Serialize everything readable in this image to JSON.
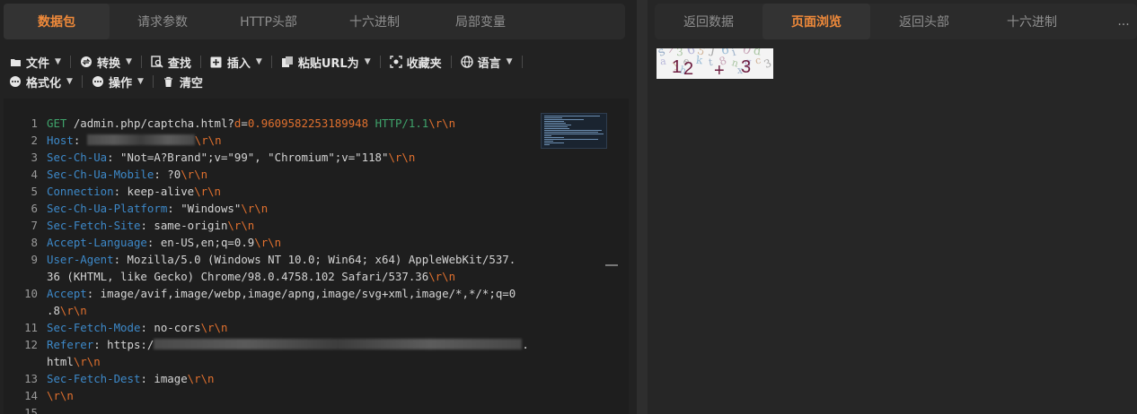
{
  "left_tabs": [
    "数据包",
    "请求参数",
    "HTTP头部",
    "十六进制",
    "局部变量"
  ],
  "toolbar": {
    "row1": [
      {
        "icon": "file-icon",
        "label": "文件",
        "caret": true
      },
      {
        "icon": "convert-icon",
        "label": "转换",
        "caret": true
      },
      {
        "icon": "search-icon",
        "label": "查找",
        "caret": false
      },
      {
        "icon": "plus-square-icon",
        "label": "插入",
        "caret": true
      },
      {
        "icon": "paste-icon",
        "label": "粘贴URL为",
        "caret": true
      },
      {
        "icon": "scan-icon",
        "label": "收藏夹",
        "caret": false
      },
      {
        "icon": "globe-icon",
        "label": "语言",
        "caret": true
      }
    ],
    "row2": [
      {
        "icon": "dots-circle-icon",
        "label": "格式化",
        "caret": true
      },
      {
        "icon": "dots-circle-icon",
        "label": "操作",
        "caret": true
      },
      {
        "icon": "trash-icon",
        "label": "清空",
        "caret": false
      }
    ]
  },
  "editor": {
    "line_numbers": [
      "1",
      "",
      "2",
      "3",
      "4",
      "5",
      "6",
      "7",
      "8",
      "9",
      "",
      "10",
      "",
      "11",
      "12",
      "",
      "13",
      "14",
      "15"
    ],
    "lines": [
      {
        "n": "1",
        "parts": [
          [
            "g",
            "GET"
          ],
          [
            "t",
            " /admin.php/captcha.html?"
          ],
          [
            "o",
            "d"
          ],
          [
            "t",
            "="
          ],
          [
            "o",
            "0.9609582253189948"
          ],
          [
            "t",
            " "
          ],
          [
            "g",
            "HTTP/1.1"
          ],
          [
            "o",
            "\\r\\n"
          ]
        ]
      },
      {
        "n": "2",
        "parts": [
          [
            "k",
            "Host"
          ],
          [
            "t",
            ": "
          ],
          [
            "b",
            "120"
          ],
          [
            "o",
            "\\r\\n"
          ]
        ]
      },
      {
        "n": "3",
        "parts": [
          [
            "k",
            "Sec-Ch-Ua"
          ],
          [
            "t",
            ": \"Not=A?Brand\";v=\"99\", \"Chromium\";v=\"118\""
          ],
          [
            "o",
            "\\r\\n"
          ]
        ]
      },
      {
        "n": "4",
        "parts": [
          [
            "k",
            "Sec-Ch-Ua-Mobile"
          ],
          [
            "t",
            ": ?0"
          ],
          [
            "o",
            "\\r\\n"
          ]
        ]
      },
      {
        "n": "5",
        "parts": [
          [
            "k",
            "Connection"
          ],
          [
            "t",
            ": keep-alive"
          ],
          [
            "o",
            "\\r\\n"
          ]
        ]
      },
      {
        "n": "6",
        "parts": [
          [
            "k",
            "Sec-Ch-Ua-Platform"
          ],
          [
            "t",
            ": \"Windows\""
          ],
          [
            "o",
            "\\r\\n"
          ]
        ]
      },
      {
        "n": "7",
        "parts": [
          [
            "k",
            "Sec-Fetch-Site"
          ],
          [
            "t",
            ": same-origin"
          ],
          [
            "o",
            "\\r\\n"
          ]
        ]
      },
      {
        "n": "8",
        "parts": [
          [
            "k",
            "Accept-Language"
          ],
          [
            "t",
            ": en-US,en;q=0.9"
          ],
          [
            "o",
            "\\r\\n"
          ]
        ]
      },
      {
        "n": "9",
        "parts": [
          [
            "k",
            "User-Agent"
          ],
          [
            "t",
            ": Mozilla/5.0 (Windows NT 10.0; Win64; x64) AppleWebKit/537."
          ]
        ]
      },
      {
        "n": "",
        "parts": [
          [
            "t",
            "36 (KHTML, like Gecko) Chrome/98.0.4758.102 Safari/537.36"
          ],
          [
            "o",
            "\\r\\n"
          ]
        ]
      },
      {
        "n": "10",
        "parts": [
          [
            "k",
            "Accept"
          ],
          [
            "t",
            ": image/avif,image/webp,image/apng,image/svg+xml,image/*,*/*;q=0"
          ]
        ]
      },
      {
        "n": "",
        "parts": [
          [
            "t",
            ".8"
          ],
          [
            "o",
            "\\r\\n"
          ]
        ]
      },
      {
        "n": "11",
        "parts": [
          [
            "k",
            "Sec-Fetch-Mode"
          ],
          [
            "t",
            ": no-cors"
          ],
          [
            "o",
            "\\r\\n"
          ]
        ]
      },
      {
        "n": "12",
        "parts": [
          [
            "k",
            "Referer"
          ],
          [
            "t",
            ": https:/"
          ],
          [
            "b",
            "410"
          ],
          [
            "t",
            "."
          ]
        ]
      },
      {
        "n": "",
        "parts": [
          [
            "t",
            "html"
          ],
          [
            "o",
            "\\r\\n"
          ]
        ]
      },
      {
        "n": "13",
        "parts": [
          [
            "k",
            "Sec-Fetch-Dest"
          ],
          [
            "t",
            ": image"
          ],
          [
            "o",
            "\\r\\n"
          ]
        ]
      },
      {
        "n": "14",
        "parts": [
          [
            "o",
            "\\r\\n"
          ]
        ]
      },
      {
        "n": "15",
        "parts": []
      }
    ]
  },
  "right_tabs": [
    "返回数据",
    "页面浏览",
    "返回头部",
    "十六进制"
  ],
  "right_more": "···",
  "captcha": {
    "main_chars": [
      "1",
      "2",
      "+",
      "3"
    ],
    "noise_chars": [
      "s",
      "7",
      "3",
      "6",
      "5",
      "J",
      "6",
      "i",
      "0",
      "d",
      "a",
      "y",
      "e",
      "k",
      "t",
      "8",
      "n",
      "g",
      "c",
      "3",
      "h",
      "x"
    ],
    "main_color": "#6e1d40"
  },
  "colors": {
    "active_tab": "#f08a3a",
    "header_key": "#3d89c9",
    "method": "#3fa36b",
    "crlf": "#e0702e"
  }
}
